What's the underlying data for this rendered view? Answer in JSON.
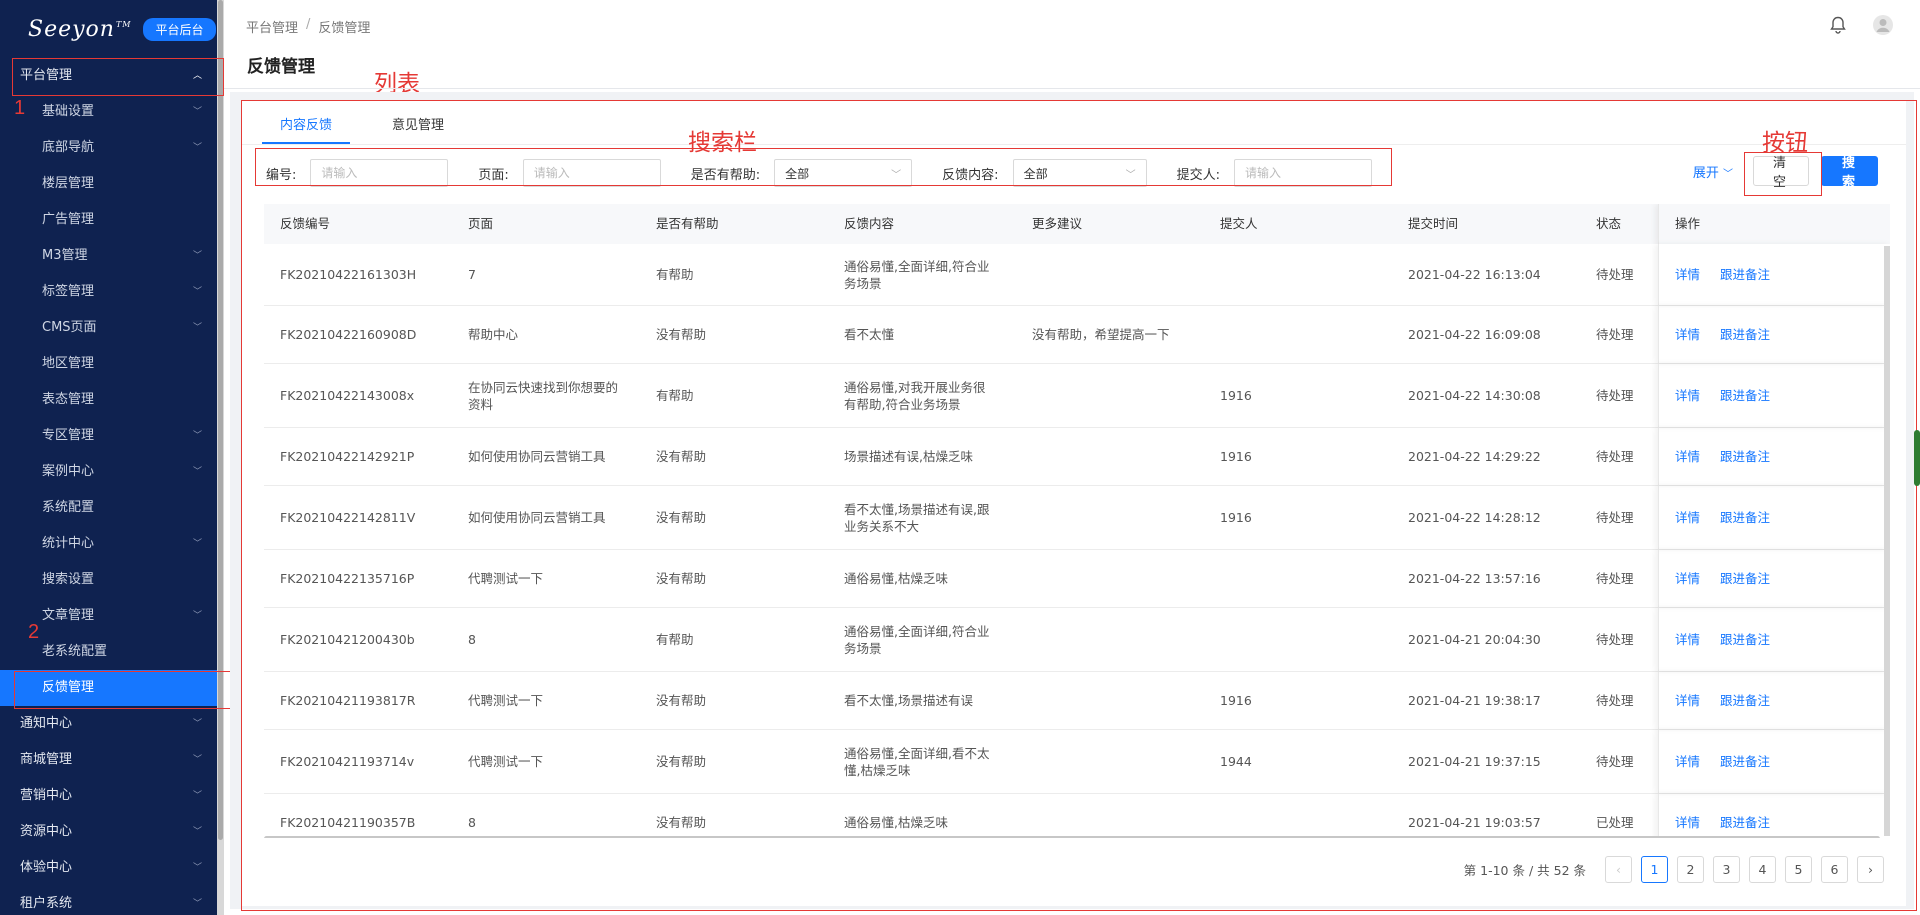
{
  "sidebar": {
    "logo": "Seeyon",
    "logo_tm": "TM",
    "platform_badge": "平台后台",
    "group_platform": "平台管理",
    "items": [
      {
        "label": "基础设置",
        "chevron": true
      },
      {
        "label": "底部导航",
        "chevron": true
      },
      {
        "label": "楼层管理",
        "chevron": false
      },
      {
        "label": "广告管理",
        "chevron": false
      },
      {
        "label": "M3管理",
        "chevron": true
      },
      {
        "label": "标签管理",
        "chevron": true
      },
      {
        "label": "CMS页面",
        "chevron": true
      },
      {
        "label": "地区管理",
        "chevron": false
      },
      {
        "label": "表态管理",
        "chevron": false
      },
      {
        "label": "专区管理",
        "chevron": true
      },
      {
        "label": "案例中心",
        "chevron": true
      },
      {
        "label": "系统配置",
        "chevron": false
      },
      {
        "label": "统计中心",
        "chevron": true
      },
      {
        "label": "搜索设置",
        "chevron": false
      },
      {
        "label": "文章管理",
        "chevron": true
      },
      {
        "label": "老系统配置",
        "chevron": false
      },
      {
        "label": "反馈管理",
        "chevron": false,
        "active": true
      }
    ],
    "groups": [
      {
        "label": "通知中心"
      },
      {
        "label": "商城管理"
      },
      {
        "label": "营销中心"
      },
      {
        "label": "资源中心"
      },
      {
        "label": "体验中心"
      },
      {
        "label": "租户系统"
      }
    ]
  },
  "annotations": {
    "n1": "1",
    "n2": "2",
    "list": "列表",
    "searchbar": "搜索栏",
    "buttons": "按钮"
  },
  "breadcrumb": {
    "root": "平台管理",
    "sep": "/",
    "current": "反馈管理"
  },
  "page_title": "反馈管理",
  "tabs": [
    "内容反馈",
    "意见管理"
  ],
  "search": {
    "id_label": "编号:",
    "id_placeholder": "请输入",
    "page_label": "页面:",
    "page_placeholder": "请输入",
    "helpful_label": "是否有帮助:",
    "helpful_value": "全部",
    "content_label": "反馈内容:",
    "content_value": "全部",
    "submitter_label": "提交人:",
    "submitter_placeholder": "请输入"
  },
  "toolbar": {
    "expand": "展开",
    "clear": "清空",
    "search": "搜索"
  },
  "table": {
    "columns": [
      "反馈编号",
      "页面",
      "是否有帮助",
      "反馈内容",
      "更多建议",
      "提交人",
      "提交时间",
      "状态",
      "操作"
    ],
    "actions": {
      "detail": "详情",
      "follow": "跟进备注"
    },
    "rows": [
      {
        "id": "FK20210422161303H",
        "page": "7",
        "helpful": "有帮助",
        "content": "通俗易懂,全面详细,符合业务场景",
        "suggest": "",
        "submitter": "",
        "time": "2021-04-22 16:13:04",
        "status": "待处理"
      },
      {
        "id": "FK20210422160908D",
        "page": "帮助中心",
        "helpful": "没有帮助",
        "content": "看不太懂",
        "suggest": "没有帮助，希望提高一下",
        "submitter": "",
        "time": "2021-04-22 16:09:08",
        "status": "待处理"
      },
      {
        "id": "FK20210422143008x",
        "page": "在协同云快速找到你想要的资料",
        "helpful": "有帮助",
        "content": "通俗易懂,对我开展业务很有帮助,符合业务场景",
        "suggest": "",
        "submitter": "1916",
        "time": "2021-04-22 14:30:08",
        "status": "待处理"
      },
      {
        "id": "FK20210422142921P",
        "page": "如何使用协同云营销工具",
        "helpful": "没有帮助",
        "content": "场景描述有误,枯燥乏味",
        "suggest": "",
        "submitter": "1916",
        "time": "2021-04-22 14:29:22",
        "status": "待处理"
      },
      {
        "id": "FK20210422142811V",
        "page": "如何使用协同云营销工具",
        "helpful": "没有帮助",
        "content": "看不太懂,场景描述有误,跟业务关系不大",
        "suggest": "",
        "submitter": "1916",
        "time": "2021-04-22 14:28:12",
        "status": "待处理"
      },
      {
        "id": "FK20210422135716P",
        "page": "代聘测试一下",
        "helpful": "没有帮助",
        "content": "通俗易懂,枯燥乏味",
        "suggest": "",
        "submitter": "",
        "time": "2021-04-22 13:57:16",
        "status": "待处理"
      },
      {
        "id": "FK20210421200430b",
        "page": "8",
        "helpful": "有帮助",
        "content": "通俗易懂,全面详细,符合业务场景",
        "suggest": "",
        "submitter": "",
        "time": "2021-04-21 20:04:30",
        "status": "待处理"
      },
      {
        "id": "FK20210421193817R",
        "page": "代聘测试一下",
        "helpful": "没有帮助",
        "content": "看不太懂,场景描述有误",
        "suggest": "",
        "submitter": "1916",
        "time": "2021-04-21 19:38:17",
        "status": "待处理"
      },
      {
        "id": "FK20210421193714v",
        "page": "代聘测试一下",
        "helpful": "没有帮助",
        "content": "通俗易懂,全面详细,看不太懂,枯燥乏味",
        "suggest": "",
        "submitter": "1944",
        "time": "2021-04-21 19:37:15",
        "status": "待处理"
      },
      {
        "id": "FK20210421190357B",
        "page": "8",
        "helpful": "没有帮助",
        "content": "通俗易懂,枯燥乏味",
        "suggest": "",
        "submitter": "",
        "time": "2021-04-21 19:03:57",
        "status": "已处理"
      }
    ]
  },
  "pagination": {
    "summary": "第 1-10 条 / 共 52 条",
    "pages": [
      "1",
      "2",
      "3",
      "4",
      "5",
      "6"
    ],
    "current": "1",
    "prev": "‹",
    "next": "›"
  },
  "colors": {
    "sidebar_bg": "#0f2250",
    "accent": "#1677ff",
    "annotation": "#e53935"
  }
}
